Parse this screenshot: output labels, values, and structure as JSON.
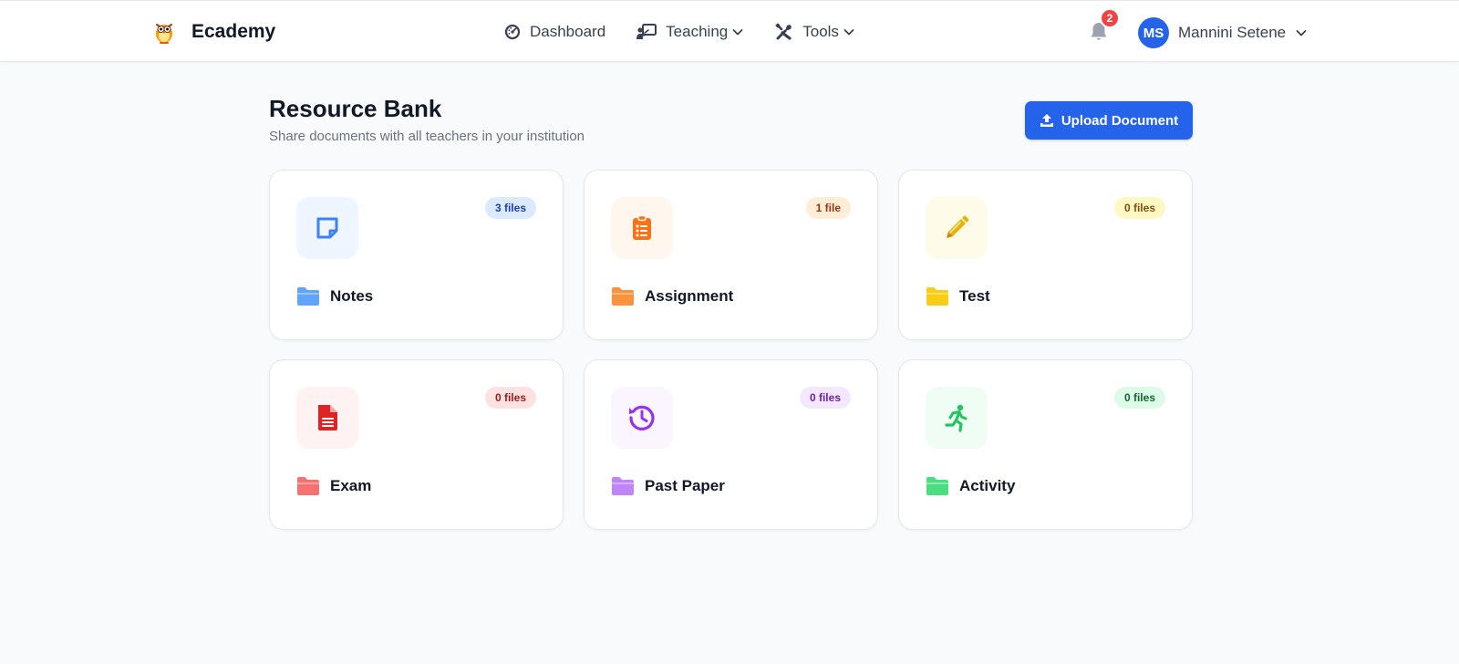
{
  "navbar": {
    "brand": {
      "name": "Ecademy",
      "logo_icon": "owl-logo-icon"
    },
    "links": [
      {
        "label": "Dashboard",
        "icon": "gauge-icon",
        "dropdown": false
      },
      {
        "label": "Teaching",
        "icon": "teacher-board-icon",
        "dropdown": true
      },
      {
        "label": "Tools",
        "icon": "tools-icon",
        "dropdown": true
      }
    ],
    "notifications": {
      "count": "2",
      "icon": "bell-icon"
    },
    "user": {
      "initials": "MS",
      "name": "Mannini Setene"
    }
  },
  "page": {
    "title": "Resource Bank",
    "subtitle": "Share documents with all teachers in your institution",
    "upload_label": "Upload Document"
  },
  "colors": {
    "primary": "#2563eb",
    "badge_alert": "#ef4444"
  },
  "categories": [
    {
      "label": "Notes",
      "count": "3 files",
      "icon": "sticky-note-icon",
      "accent": "#3b82f6",
      "icon_bg": "#eff6ff",
      "badge_bg": "#dbeafe",
      "badge_fg": "#1e40af",
      "folder": "#60a5fa"
    },
    {
      "label": "Assignment",
      "count": "1 file",
      "icon": "clipboard-list-icon",
      "accent": "#f97316",
      "icon_bg": "#fff7ed",
      "badge_bg": "#ffedd5",
      "badge_fg": "#9a3412",
      "folder": "#fb923c"
    },
    {
      "label": "Test",
      "count": "0 files",
      "icon": "pencil-icon",
      "accent": "#eab308",
      "icon_bg": "#fefce8",
      "badge_bg": "#fef9c3",
      "badge_fg": "#854d0e",
      "folder": "#facc15"
    },
    {
      "label": "Exam",
      "count": "0 files",
      "icon": "file-document-icon",
      "accent": "#dc2626",
      "icon_bg": "#fef2f2",
      "badge_bg": "#fee2e2",
      "badge_fg": "#991b1b",
      "folder": "#f87171"
    },
    {
      "label": "Past Paper",
      "count": "0 files",
      "icon": "history-icon",
      "accent": "#9333ea",
      "icon_bg": "#faf5ff",
      "badge_bg": "#f3e8ff",
      "badge_fg": "#6b21a8",
      "folder": "#c084fc"
    },
    {
      "label": "Activity",
      "count": "0 files",
      "icon": "running-person-icon",
      "accent": "#22c55e",
      "icon_bg": "#f0fdf4",
      "badge_bg": "#dcfce7",
      "badge_fg": "#166534",
      "folder": "#4ade80"
    }
  ]
}
